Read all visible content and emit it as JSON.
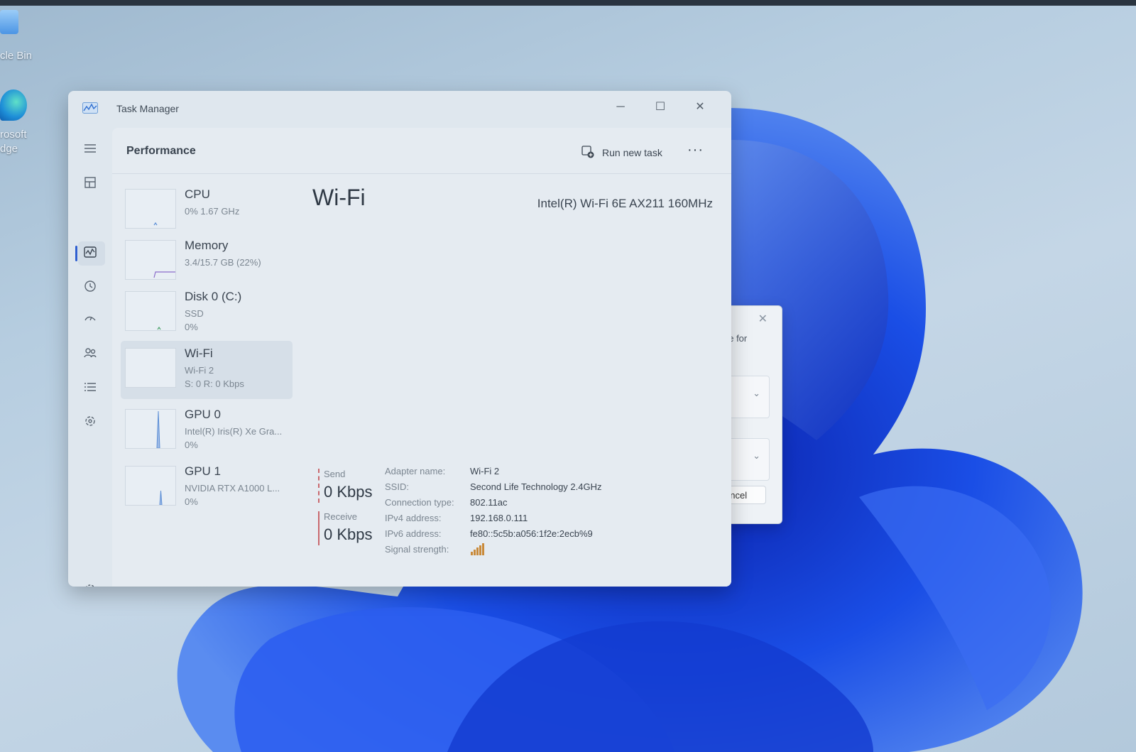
{
  "desktop": {
    "icons": [
      {
        "label": "cle Bin",
        "icon": "recycle-bin-icon"
      },
      {
        "label": "rosoft\ndge",
        "icon": "edge-icon"
      }
    ]
  },
  "window": {
    "title": "Task Manager",
    "controls": {
      "minimize": "─",
      "maximize": "☐",
      "close": "✕"
    }
  },
  "header": {
    "title": "Performance",
    "run_new_task": "Run new task",
    "more": "···"
  },
  "devices": [
    {
      "name": "CPU",
      "sub1": "0%  1.67 GHz",
      "sub2": ""
    },
    {
      "name": "Memory",
      "sub1": "3.4/15.7 GB (22%)",
      "sub2": ""
    },
    {
      "name": "Disk 0 (C:)",
      "sub1": "SSD",
      "sub2": "0%"
    },
    {
      "name": "Wi-Fi",
      "sub1": "Wi-Fi 2",
      "sub2": "S: 0 R: 0 Kbps"
    },
    {
      "name": "GPU 0",
      "sub1": "Intel(R) Iris(R) Xe Gra...",
      "sub2": "0%"
    },
    {
      "name": "GPU 1",
      "sub1": "NVIDIA RTX A1000 L...",
      "sub2": "0%"
    }
  ],
  "main": {
    "title": "Wi-Fi",
    "adapter": "Intel(R) Wi-Fi 6E AX211 160MHz",
    "send_label": "Send",
    "send_value": "0 Kbps",
    "receive_label": "Receive",
    "receive_value": "0 Kbps",
    "properties": [
      {
        "key": "Adapter name:",
        "value": "Wi-Fi 2"
      },
      {
        "key": "SSID:",
        "value": "Second Life Technology 2.4GHz"
      },
      {
        "key": "Connection type:",
        "value": "802.11ac"
      },
      {
        "key": "IPv4 address:",
        "value": "192.168.0.111"
      },
      {
        "key": "IPv6 address:",
        "value": "fe80::5c5b:a056:1f2e:2ecb%9"
      },
      {
        "key": "Signal strength:",
        "value": ""
      }
    ]
  },
  "dialog": {
    "text": "ne for",
    "close": "✕",
    "chevron": "⌄",
    "cancel": "ancel"
  },
  "colors": {
    "accent": "#2f5fd0",
    "rate_line": "#c9686d",
    "signal": "#c98a3a",
    "graph_line": "#5d8fd6"
  }
}
